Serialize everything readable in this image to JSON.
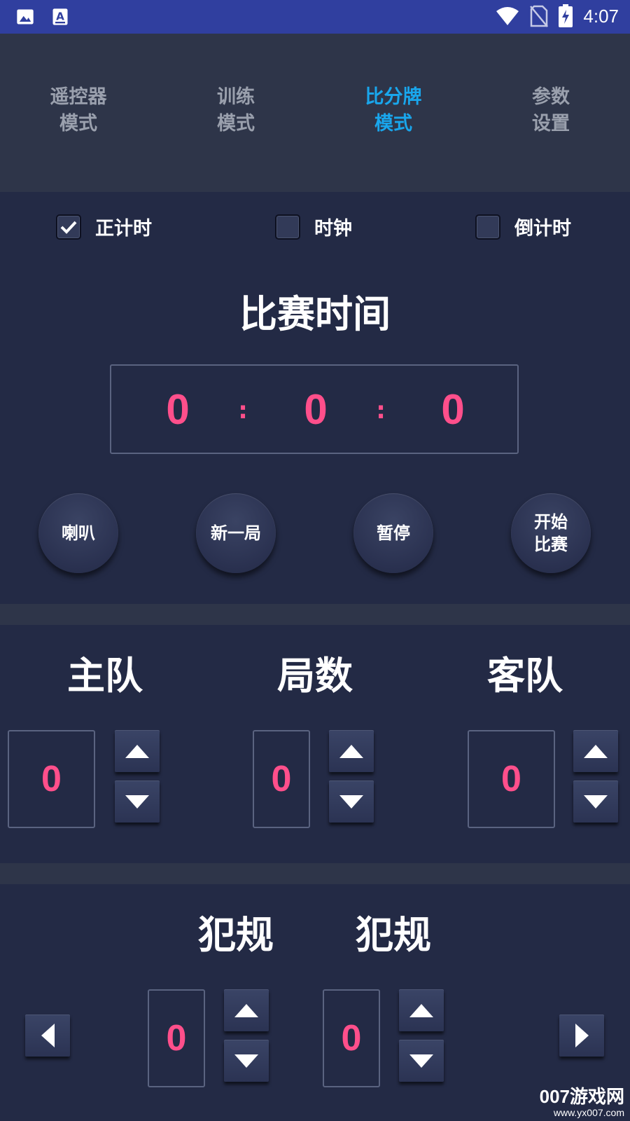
{
  "status_bar": {
    "time": "4:07",
    "left_icons": [
      "image-icon",
      "font-a-icon"
    ],
    "right_icons": [
      "wifi-icon",
      "no-sim-icon",
      "battery-charging-icon"
    ]
  },
  "tabs": [
    {
      "line1": "遥控器",
      "line2": "模式",
      "active": false
    },
    {
      "line1": "训练",
      "line2": "模式",
      "active": false
    },
    {
      "line1": "比分牌",
      "line2": "模式",
      "active": true
    },
    {
      "line1": "参数",
      "line2": "设置",
      "active": false
    }
  ],
  "timer_modes": [
    {
      "label": "正计时",
      "checked": true
    },
    {
      "label": "时钟",
      "checked": false
    },
    {
      "label": "倒计时",
      "checked": false
    }
  ],
  "timer": {
    "title": "比赛时间",
    "hours": "0",
    "minutes": "0",
    "seconds": "0",
    "separator": ":"
  },
  "controls": {
    "horn": "喇叭",
    "new_round": "新一局",
    "pause": "暂停",
    "start_line1": "开始",
    "start_line2": "比赛"
  },
  "score": {
    "home_label": "主队",
    "rounds_label": "局数",
    "away_label": "客队",
    "home_value": "0",
    "rounds_value": "0",
    "away_value": "0"
  },
  "fouls": {
    "home_label": "犯规",
    "away_label": "犯规",
    "home_value": "0",
    "away_value": "0"
  },
  "watermark": {
    "brand": "007游戏网",
    "url": "www.yx007.com"
  },
  "colors": {
    "status_bar": "#303f9f",
    "background": "#232a45",
    "panel": "#2e3549",
    "active_tab": "#19a6ec",
    "inactive_tab": "#9aa0ad",
    "digits": "#ff4f8b"
  }
}
